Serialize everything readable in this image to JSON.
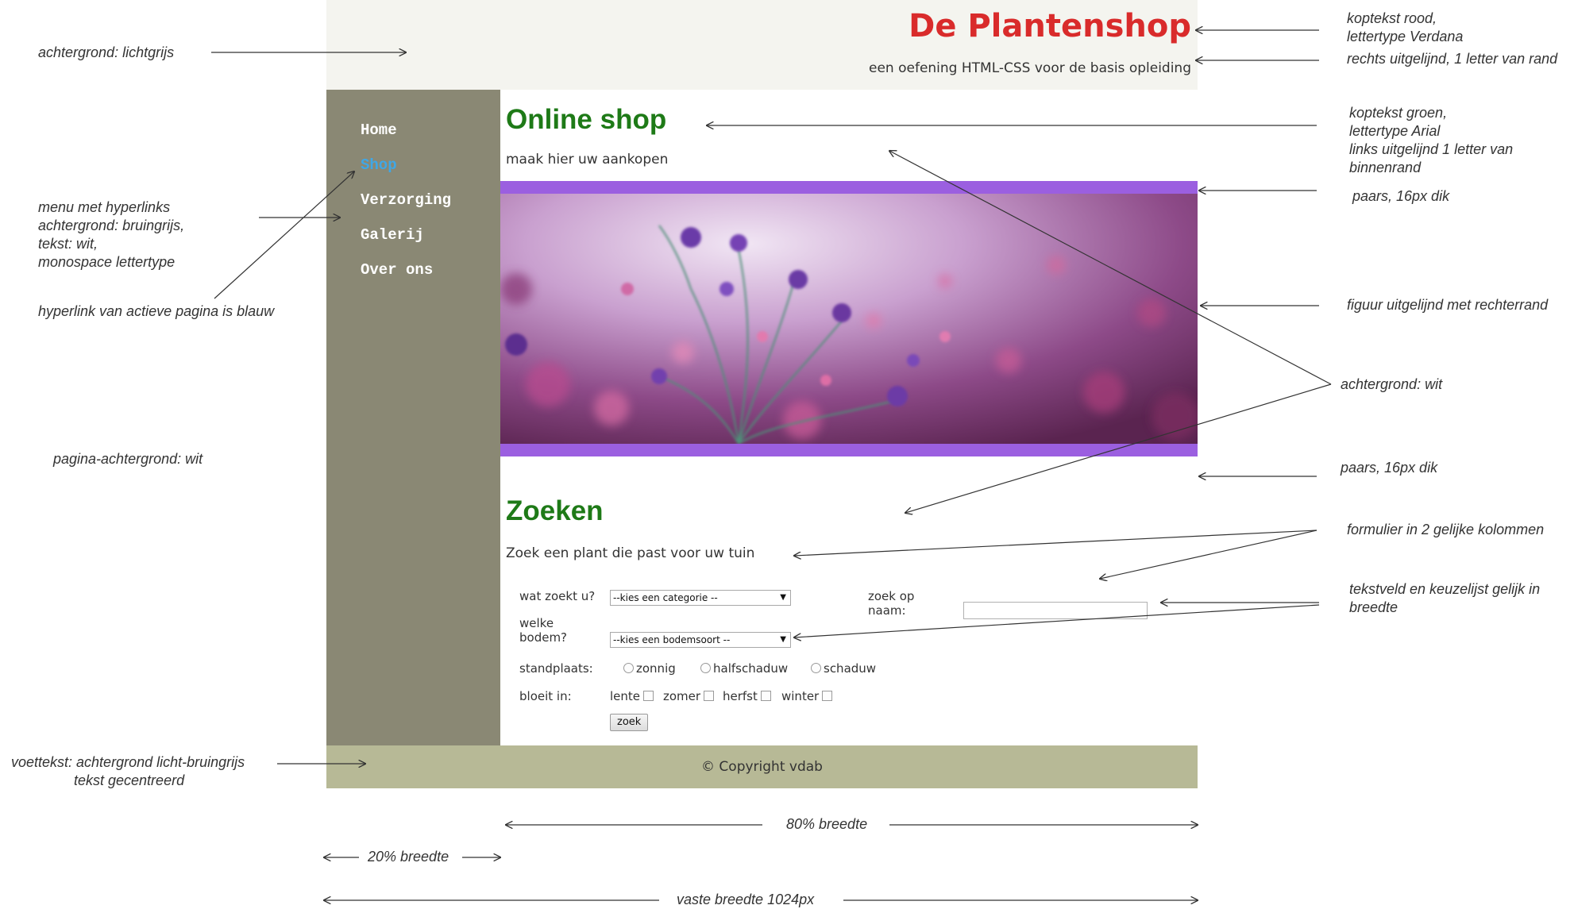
{
  "header": {
    "title": "De Plantenshop",
    "subtitle": "een oefening HTML-CSS voor de basis opleiding"
  },
  "nav": {
    "items": [
      {
        "label": "Home",
        "active": false
      },
      {
        "label": "Shop",
        "active": true
      },
      {
        "label": "Verzorging",
        "active": false
      },
      {
        "label": "Galerij",
        "active": false
      },
      {
        "label": "Over ons",
        "active": false
      }
    ]
  },
  "main": {
    "heading": "Online shop",
    "intro": "maak hier uw aankopen",
    "search_heading": "Zoeken",
    "search_intro": "Zoek een plant die past voor uw tuin"
  },
  "form": {
    "category_label": "wat zoekt u?",
    "category_value": "--kies een categorie --",
    "soil_label_1": "welke",
    "soil_label_2": "bodem?",
    "soil_value": "--kies een bodemsoort --",
    "name_label_1": "zoek op",
    "name_label_2": "naam:",
    "name_value": "",
    "location_label": "standplaats:",
    "location_options": [
      "zonnig",
      "halfschaduw",
      "schaduw"
    ],
    "bloom_label": "bloeit in:",
    "bloom_options": [
      "lente",
      "zomer",
      "herfst",
      "winter"
    ],
    "submit_label": "zoek"
  },
  "footer": {
    "text": "© Copyright vdab"
  },
  "annotations": {
    "bg_header": "achtergrond: lichtgrijs",
    "menu_1": "menu met  hyperlinks",
    "menu_2": "achtergrond: bruingrijs,",
    "menu_3": "tekst: wit,",
    "menu_4": "monospace lettertype",
    "active_link": "hyperlink van actieve pagina is blauw",
    "page_bg": "pagina-achtergrond: wit",
    "footer_1": "voettekst: achtergrond licht-bruingrijs",
    "footer_2": "tekst gecentreerd",
    "title_1": "koptekst rood,",
    "title_2": "lettertype Verdana",
    "title_3": "rechts uitgelijnd, 1 letter van rand",
    "heading_1": "koptekst groen,",
    "heading_2": "lettertype Arial",
    "heading_3": "links uitgelijnd 1 letter van",
    "heading_4": "binnenrand",
    "purple_top": "paars, 16px dik",
    "figure_right": "figuur uitgelijnd met rechterrand",
    "main_bg": "achtergrond: wit",
    "purple_bottom": "paars, 16px dik",
    "form_cols": "formulier in 2 gelijke kolommen",
    "equal_1": "tekstveld en keuzelijst gelijk in",
    "equal_2": "breedte",
    "width_main": "80% breedte",
    "width_nav": "20% breedte",
    "width_fixed": "vaste breedte 1024px"
  },
  "colors": {
    "header_bg": "#f4f4ef",
    "title_red": "#d92b2b",
    "nav_bg": "#8a8874",
    "active_blue": "#3fa7e6",
    "heading_green": "#1e7a17",
    "border_purple": "#9b5fe0",
    "footer_bg": "#b7b996"
  }
}
